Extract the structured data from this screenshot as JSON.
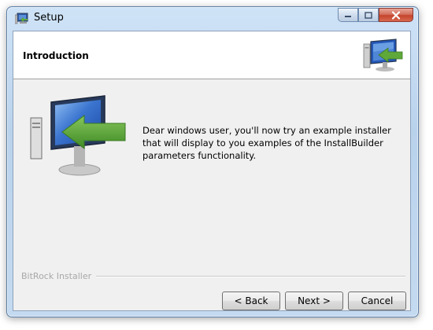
{
  "window": {
    "title": "Setup"
  },
  "header": {
    "title": "Introduction"
  },
  "main": {
    "text": "Dear windows user, you'll now try an example installer that will display to you examples of the InstallBuilder parameters functionality."
  },
  "footer": {
    "brand": "BitRock Installer",
    "buttons": {
      "back": "< Back",
      "next": "Next >",
      "cancel": "Cancel"
    }
  },
  "icons": {
    "app": "setup-icon",
    "header_logo": "installer-computer-icon",
    "main_logo": "installer-computer-icon",
    "minimize": "minimize-icon",
    "maximize": "maximize-icon",
    "close": "close-icon"
  },
  "colors": {
    "accent_green": "#5fa83a",
    "screen_blue": "#2458b8",
    "close_red": "#c5442b"
  }
}
